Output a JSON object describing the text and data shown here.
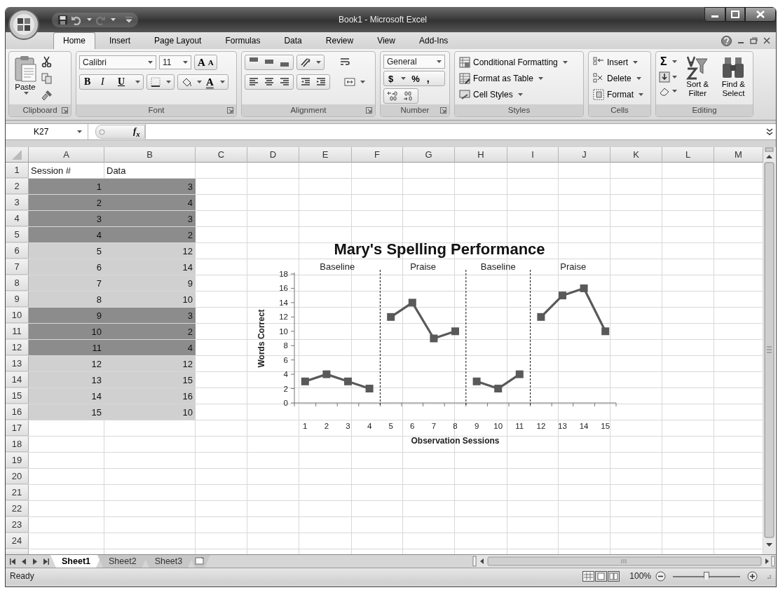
{
  "title_bar": {
    "title": "Book1 - Microsoft Excel"
  },
  "tabs": [
    {
      "label": "Home",
      "selected": true
    },
    {
      "label": "Insert",
      "selected": false
    },
    {
      "label": "Page Layout",
      "selected": false
    },
    {
      "label": "Formulas",
      "selected": false
    },
    {
      "label": "Data",
      "selected": false
    },
    {
      "label": "Review",
      "selected": false
    },
    {
      "label": "View",
      "selected": false
    },
    {
      "label": "Add-Ins",
      "selected": false
    }
  ],
  "ribbon": {
    "clipboard": {
      "label": "Clipboard",
      "paste": "Paste"
    },
    "font": {
      "label": "Font",
      "name": "Calibri",
      "size": "11",
      "grow": "A",
      "shrink": "A",
      "bold": "B",
      "italic": "I",
      "underline": "U",
      "color_button": "A"
    },
    "alignment": {
      "label": "Alignment"
    },
    "number": {
      "label": "Number",
      "format": "General",
      "currency": "$",
      "percent": "%",
      "comma": ","
    },
    "styles": {
      "label": "Styles",
      "buttons": [
        "Conditional Formatting",
        "Format as Table",
        "Cell Styles"
      ]
    },
    "cells": {
      "label": "Cells",
      "buttons": [
        "Insert",
        "Delete",
        "Format"
      ]
    },
    "editing": {
      "label": "Editing",
      "sum": "Σ",
      "buttons": [
        "Sort & Filter",
        "Find & Select"
      ]
    }
  },
  "formula_bar": {
    "name_box": "K27",
    "fx": "f$_{x}$"
  },
  "sheet": {
    "columns": [
      "A",
      "B",
      "C",
      "D",
      "E",
      "F",
      "G",
      "H",
      "I",
      "J",
      "K",
      "L",
      "M"
    ],
    "row_numbers": [
      "1",
      "2",
      "3",
      "4",
      "5",
      "6",
      "7",
      "8",
      "9",
      "10",
      "11",
      "12",
      "13",
      "14",
      "15",
      "16",
      "17",
      "18",
      "19",
      "20",
      "21",
      "22",
      "23",
      "24"
    ],
    "rows": [
      {
        "kind": "text",
        "cells": [
          "Session #",
          "Data"
        ]
      },
      {
        "kind": "number",
        "cells": [
          "1",
          "3"
        ],
        "color": "#8c8c8c"
      },
      {
        "kind": "number",
        "cells": [
          "2",
          "4"
        ],
        "color": "#8c8c8c"
      },
      {
        "kind": "number",
        "cells": [
          "3",
          "3"
        ],
        "color": "#8c8c8c"
      },
      {
        "kind": "number",
        "cells": [
          "4",
          "2"
        ],
        "color": "#8c8c8c"
      },
      {
        "kind": "number",
        "cells": [
          "5",
          "12"
        ],
        "color": "#d0d0d0"
      },
      {
        "kind": "number",
        "cells": [
          "6",
          "14"
        ],
        "color": "#d0d0d0"
      },
      {
        "kind": "number",
        "cells": [
          "7",
          "9"
        ],
        "color": "#d0d0d0"
      },
      {
        "kind": "number",
        "cells": [
          "8",
          "10"
        ],
        "color": "#d0d0d0"
      },
      {
        "kind": "number",
        "cells": [
          "9",
          "3"
        ],
        "color": "#8c8c8c"
      },
      {
        "kind": "number",
        "cells": [
          "10",
          "2"
        ],
        "color": "#8c8c8c"
      },
      {
        "kind": "number",
        "cells": [
          "11",
          "4"
        ],
        "color": "#8c8c8c"
      },
      {
        "kind": "number",
        "cells": [
          "12",
          "12"
        ],
        "color": "#d0d0d0"
      },
      {
        "kind": "number",
        "cells": [
          "13",
          "15"
        ],
        "color": "#d0d0d0"
      },
      {
        "kind": "number",
        "cells": [
          "14",
          "16"
        ],
        "color": "#d0d0d0"
      },
      {
        "kind": "number",
        "cells": [
          "15",
          "10"
        ],
        "color": "#d0d0d0"
      }
    ],
    "chart_data": {
      "type": "line",
      "title": "Mary's Spelling Performance",
      "xlabel": "Observation Sessions",
      "ylabel": "Words Correct",
      "categories": [
        "1",
        "2",
        "3",
        "4",
        "5",
        "6",
        "7",
        "8",
        "9",
        "10",
        "11",
        "12",
        "13",
        "14",
        "15"
      ],
      "series": [
        {
          "color": "#595959",
          "marker": "square",
          "values": [
            3,
            4,
            3,
            2,
            12,
            14,
            9,
            10,
            3,
            2,
            4,
            12,
            15,
            16,
            10
          ]
        }
      ],
      "ylim": [
        0,
        18
      ],
      "yticks": [
        0,
        2,
        4,
        6,
        8,
        10,
        12,
        14,
        16,
        18
      ],
      "annotations": [
        "Baseline",
        "Praise",
        "Baseline",
        "Praise"
      ]
    }
  },
  "sheet_tabs": [
    {
      "label": "Sheet1",
      "selected": true
    },
    {
      "label": "Sheet2",
      "selected": false
    },
    {
      "label": "Sheet3",
      "selected": false
    }
  ],
  "status_bar": {
    "status": "Ready",
    "zoom": "100%",
    "zoom_slider": {
      "level": 0.5
    }
  }
}
